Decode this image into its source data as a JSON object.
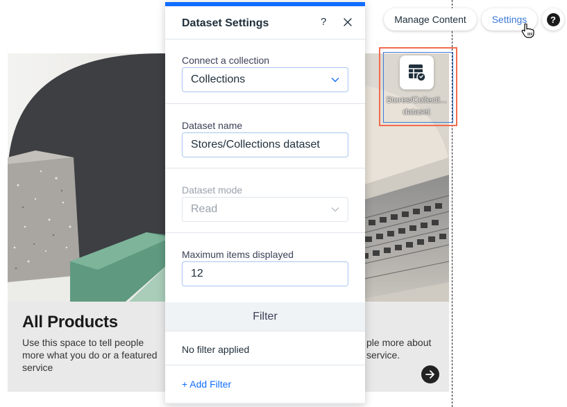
{
  "toolbar": {
    "manage_content_label": "Manage Content",
    "settings_label": "Settings",
    "help_label": "?"
  },
  "dataset_element": {
    "label_line1": "Stores/Collecti...",
    "label_line2": "dataset",
    "icon": "dataset-table-icon"
  },
  "card": {
    "title": "All Products",
    "description_left": "Use this space to tell people more what you do or a featured service",
    "description_right": "ple more about service.",
    "arrow_icon": "arrow-right-icon"
  },
  "panel": {
    "title": "Dataset Settings",
    "help_label": "?",
    "close_icon": "close-icon",
    "connect_label": "Connect a collection",
    "collection_value": "Collections",
    "dataset_name_label": "Dataset name",
    "dataset_name_value": "Stores/Collections dataset",
    "dataset_mode_label": "Dataset mode",
    "dataset_mode_value": "Read",
    "max_items_label": "Maximum items displayed",
    "max_items_value": "12",
    "filter_header": "Filter",
    "no_filter_text": "No filter applied",
    "add_filter_label": "+ Add Filter"
  },
  "colors": {
    "accent": "#116dff",
    "selection_outline": "#f26b4f",
    "settings_link": "#3b7ad9"
  }
}
